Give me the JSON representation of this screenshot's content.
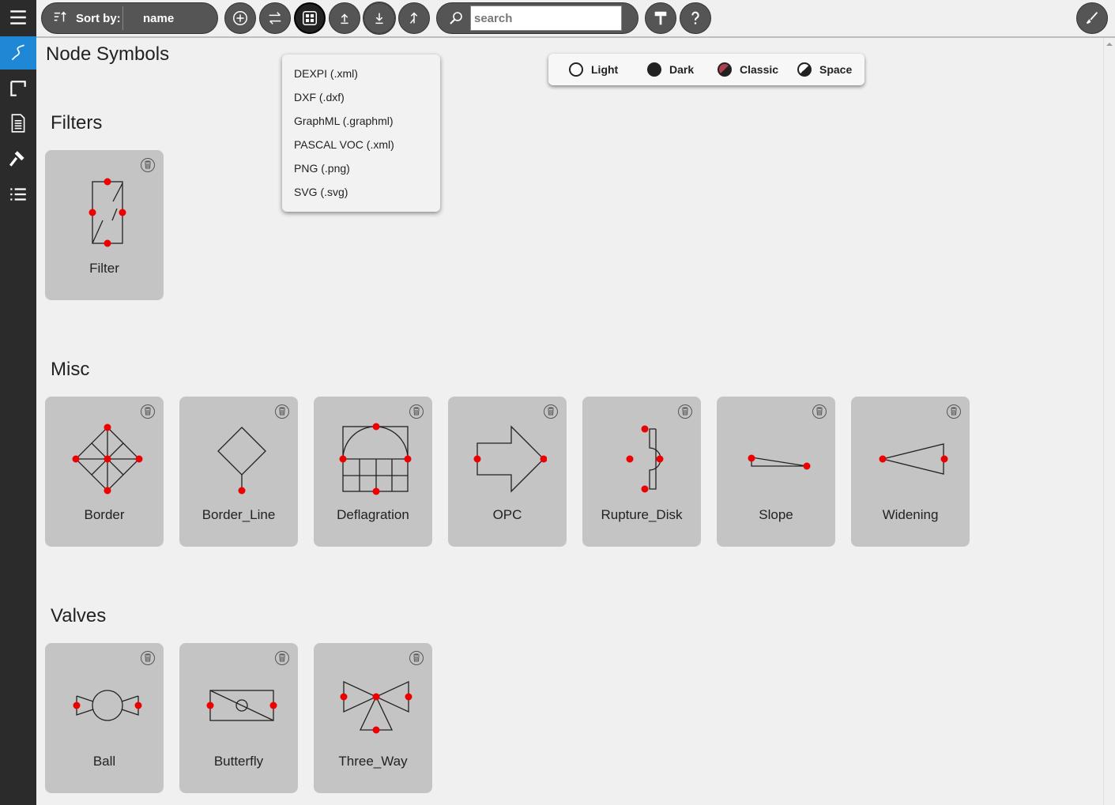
{
  "toolbar": {
    "sort_label": "Sort by:",
    "sort_value": "name",
    "search_placeholder": "search",
    "search_value": "",
    "buttons": [
      "add-icon",
      "swap-icon",
      "grid-icon",
      "upload-icon",
      "download-icon",
      "merge-icon",
      "paint-roller-icon",
      "help-icon",
      "brush-icon"
    ]
  },
  "sidebar": {
    "items": [
      "menu-icon",
      "line-icon",
      "flowchart-icon",
      "document-icon",
      "hammer-icon",
      "list-icon"
    ]
  },
  "main": {
    "title": "Node Symbols",
    "sections": [
      {
        "title": "Filters",
        "cards": [
          "Filter"
        ]
      },
      {
        "title": "Misc",
        "cards": [
          "Border",
          "Border_Line",
          "Deflagration",
          "OPC",
          "Rupture_Disk",
          "Slope",
          "Widening"
        ]
      },
      {
        "title": "Valves",
        "cards": [
          "Ball",
          "Butterfly",
          "Three_Way"
        ]
      }
    ]
  },
  "export_menu": {
    "items": [
      "DEXPI (.xml)",
      "DXF (.dxf)",
      "GraphML (.graphml)",
      "PASCAL VOC (.xml)",
      "PNG (.png)",
      "SVG (.svg)"
    ]
  },
  "theme": {
    "options": [
      "Light",
      "Dark",
      "Classic",
      "Space"
    ],
    "colors": {
      "classic_dot": "#b04050",
      "port": "#ee0000",
      "accent": "#1e88d6"
    }
  }
}
